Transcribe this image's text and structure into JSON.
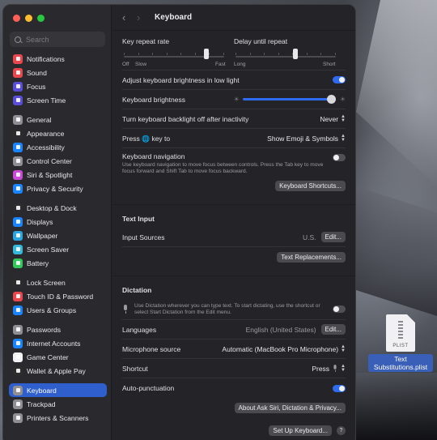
{
  "sidebar": {
    "search_placeholder": "Search",
    "groups": [
      [
        {
          "label": "Notifications",
          "icon": "bell-icon",
          "color": "#e8484d"
        },
        {
          "label": "Sound",
          "icon": "speaker-icon",
          "color": "#e8484d"
        },
        {
          "label": "Focus",
          "icon": "moon-icon",
          "color": "#5b4ed6"
        },
        {
          "label": "Screen Time",
          "icon": "hourglass-icon",
          "color": "#5b4ed6"
        }
      ],
      [
        {
          "label": "General",
          "icon": "gear-icon",
          "color": "#8e8e93"
        },
        {
          "label": "Appearance",
          "icon": "appearance-icon",
          "color": "#2c2c2e"
        },
        {
          "label": "Accessibility",
          "icon": "accessibility-icon",
          "color": "#1a84ff"
        },
        {
          "label": "Control Center",
          "icon": "control-center-icon",
          "color": "#8e8e93"
        },
        {
          "label": "Siri & Spotlight",
          "icon": "siri-icon",
          "color": "#c94ad6"
        },
        {
          "label": "Privacy & Security",
          "icon": "hand-icon",
          "color": "#1a84ff"
        }
      ],
      [
        {
          "label": "Desktop & Dock",
          "icon": "dock-icon",
          "color": "#2c2c2e"
        },
        {
          "label": "Displays",
          "icon": "display-icon",
          "color": "#1a84ff"
        },
        {
          "label": "Wallpaper",
          "icon": "wallpaper-icon",
          "color": "#2aa5e0"
        },
        {
          "label": "Screen Saver",
          "icon": "screen-saver-icon",
          "color": "#35b9d8"
        },
        {
          "label": "Battery",
          "icon": "battery-icon",
          "color": "#34c759"
        }
      ],
      [
        {
          "label": "Lock Screen",
          "icon": "lock-icon",
          "color": "#2c2c2e"
        },
        {
          "label": "Touch ID & Password",
          "icon": "fingerprint-icon",
          "color": "#e8484d"
        },
        {
          "label": "Users & Groups",
          "icon": "users-icon",
          "color": "#1a84ff"
        }
      ],
      [
        {
          "label": "Passwords",
          "icon": "key-icon",
          "color": "#8e8e93"
        },
        {
          "label": "Internet Accounts",
          "icon": "at-icon",
          "color": "#1a84ff"
        },
        {
          "label": "Game Center",
          "icon": "game-center-icon",
          "color": "#f2f2f5"
        },
        {
          "label": "Wallet & Apple Pay",
          "icon": "wallet-icon",
          "color": "#2c2c2e"
        }
      ],
      [
        {
          "label": "Keyboard",
          "icon": "keyboard-icon",
          "color": "#8e8e93",
          "active": true
        },
        {
          "label": "Trackpad",
          "icon": "trackpad-icon",
          "color": "#8e8e93"
        },
        {
          "label": "Printers & Scanners",
          "icon": "printer-icon",
          "color": "#8e8e93"
        }
      ]
    ]
  },
  "header": {
    "title": "Keyboard"
  },
  "keyboard": {
    "key_repeat_label": "Key repeat rate",
    "key_repeat_min": "Off",
    "key_repeat_slow": "Slow",
    "key_repeat_max": "Fast",
    "key_repeat_value": 0.82,
    "delay_label": "Delay until repeat",
    "delay_min": "Long",
    "delay_max": "Short",
    "delay_value": 0.6,
    "adjust_brightness_label": "Adjust keyboard brightness in low light",
    "adjust_brightness_on": true,
    "brightness_label": "Keyboard brightness",
    "brightness_value": 1.0,
    "backlight_label": "Turn keyboard backlight off after inactivity",
    "backlight_value": "Never",
    "press_label": "Press",
    "press_suffix": "key to",
    "press_value": "Show Emoji & Symbols",
    "nav_label": "Keyboard navigation",
    "nav_desc": "Use keyboard navigation to move focus between controls. Press the Tab key to move focus forward and Shift Tab to move focus backward.",
    "nav_on": false,
    "shortcuts_button": "Keyboard Shortcuts..."
  },
  "text_input": {
    "title": "Text Input",
    "sources_label": "Input Sources",
    "sources_value": "U.S.",
    "edit_button": "Edit...",
    "replacements_button": "Text Replacements..."
  },
  "dictation": {
    "title": "Dictation",
    "desc": "Use Dictation wherever you can type text. To start dictating, use the shortcut or select Start Dictation from the Edit menu.",
    "on": false,
    "languages_label": "Languages",
    "languages_value": "English (United States)",
    "edit_button": "Edit...",
    "mic_label": "Microphone source",
    "mic_value": "Automatic (MacBook Pro Microphone)",
    "shortcut_label": "Shortcut",
    "shortcut_value": "Press",
    "auto_punct_label": "Auto-punctuation",
    "auto_punct_on": true,
    "about_button": "About Ask Siri, Dictation & Privacy...",
    "setup_button": "Set Up Keyboard...",
    "help": "?"
  },
  "desktop_file": {
    "name": "Text Substitutions.plist",
    "ext": "PLIST"
  }
}
